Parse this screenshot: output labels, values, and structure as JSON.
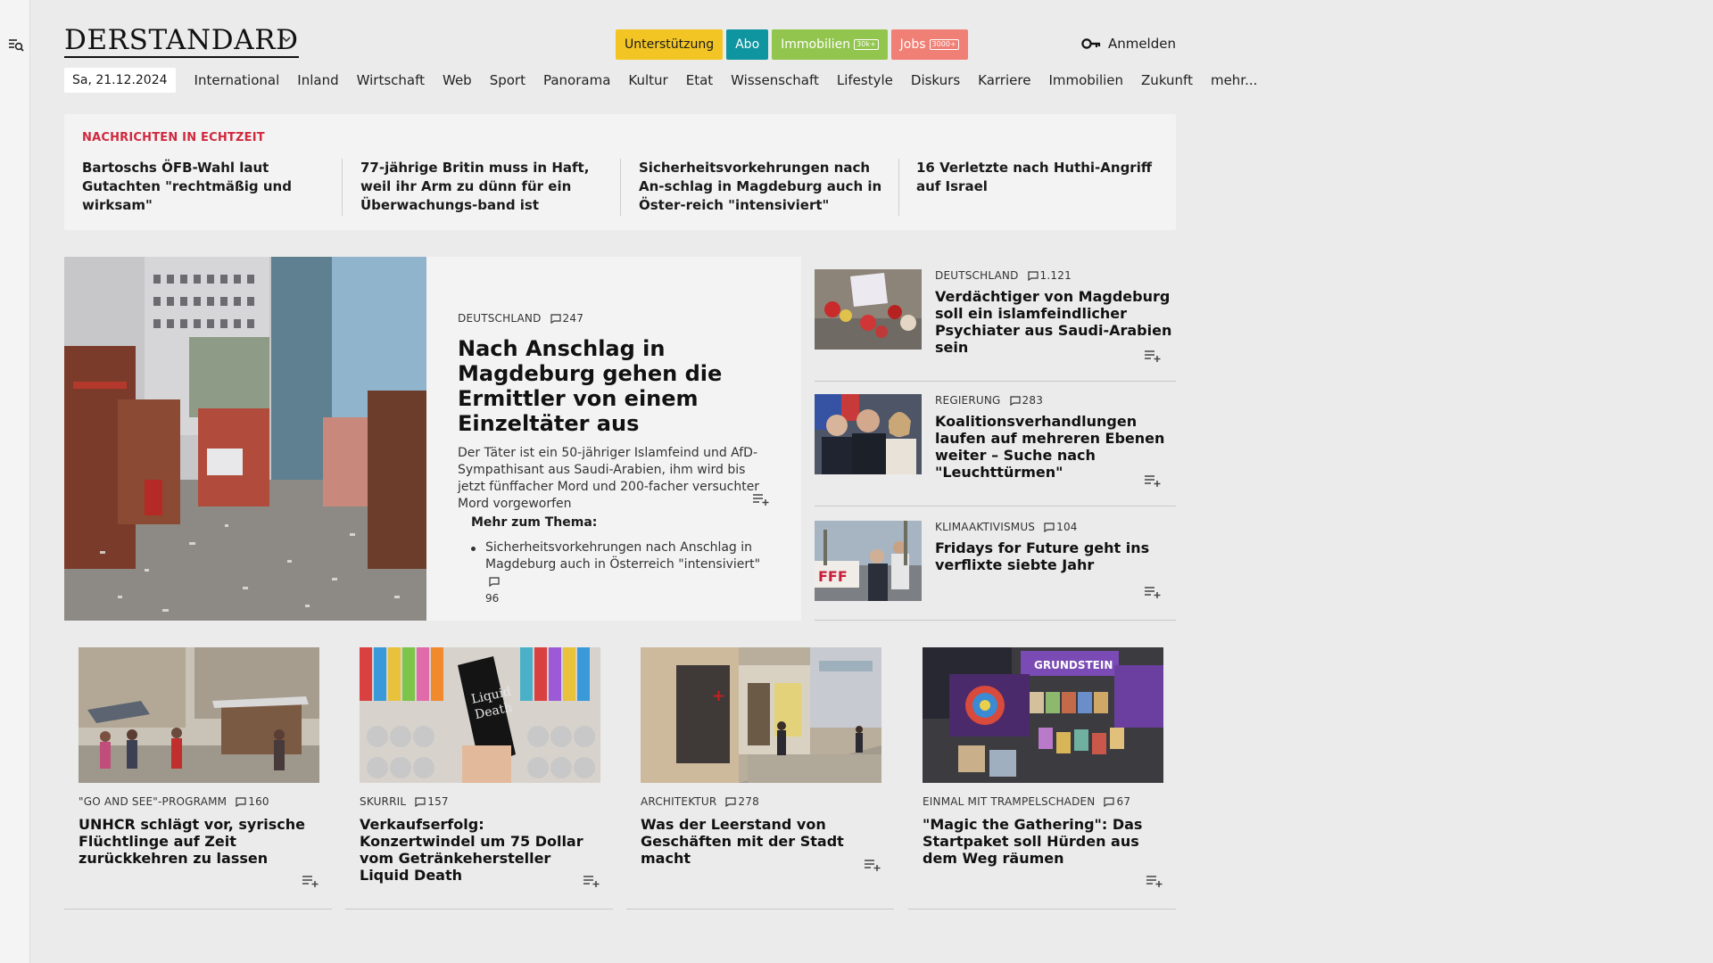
{
  "rail": {
    "icon": "search-menu-icon"
  },
  "header": {
    "logo": "DERSTANDARD",
    "buttons": {
      "support": "Unterstützung",
      "abo": "Abo",
      "immobilien": "Immobilien",
      "immobilien_badge": "30k+",
      "jobs": "Jobs",
      "jobs_badge": "3000+"
    },
    "login": "Anmelden"
  },
  "nav": {
    "date": "Sa, 21.12.2024",
    "items": [
      "International",
      "Inland",
      "Wirtschaft",
      "Web",
      "Sport",
      "Panorama",
      "Kultur",
      "Etat",
      "Wissenschaft",
      "Lifestyle",
      "Diskurs",
      "Karriere",
      "Immobilien",
      "Zukunft",
      "mehr..."
    ]
  },
  "live": {
    "title": "NACHRICHTEN IN ECHTZEIT",
    "items": [
      "Bartoschs ÖFB-Wahl laut Gutachten \"rechtmäßig und wirksam\"",
      "77-jährige Britin muss in Haft, weil ihr Arm zu dünn für ein Überwachungs-band ist",
      "Sicherheitsvorkehrungen nach An-schlag in Magdeburg auch in Öster-reich \"intensiviert\"",
      "16 Verletzte nach Huthi-Angriff auf Israel"
    ]
  },
  "hero": {
    "kicker": "DEUTSCHLAND",
    "comments": "247",
    "title": "Nach Anschlag in Magdeburg gehen die Ermittler von einem Einzeltäter aus",
    "lead": "Der Täter ist ein 50-jähriger Islamfeind und AfD-Sympathisant aus Saudi-Arabien, ihm wird bis jetzt fünffacher Mord und 200-facher versuchter Mord vorgeworfen",
    "more_title": "Mehr zum Thema:",
    "more_item": "Sicherheitsvorkehrungen nach Anschlag in Magdeburg auch in Österreich \"intensiviert\"",
    "more_comments": "96"
  },
  "side": [
    {
      "kicker": "DEUTSCHLAND",
      "comments": "1.121",
      "title": "Verdächtiger von Magdeburg soll ein islamfeindlicher Psychiater aus Saudi-Arabien sein"
    },
    {
      "kicker": "REGIERUNG",
      "comments": "283",
      "title": "Koalitionsverhandlungen laufen auf mehreren Ebenen weiter – Suche nach \"Leuchttürmen\""
    },
    {
      "kicker": "KLIMAAKTIVISMUS",
      "comments": "104",
      "title": "Fridays for Future geht ins verflixte siebte Jahr"
    }
  ],
  "cards": [
    {
      "kicker": "\"GO AND SEE\"-PROGRAMM",
      "comments": "160",
      "title": "UNHCR schlägt vor, syrische Flüchtlinge auf Zeit zurückkehren zu lassen"
    },
    {
      "kicker": "SKURRIL",
      "comments": "157",
      "title": "Verkaufserfolg: Konzertwindel um 75 Dollar vom Getränkehersteller Liquid Death"
    },
    {
      "kicker": "ARCHITEKTUR",
      "comments": "278",
      "title": "Was der Leerstand von Geschäften mit der Stadt macht"
    },
    {
      "kicker": "EINMAL MIT TRAMPELSCHADEN",
      "comments": "67",
      "title": "\"Magic the Gathering\": Das Startpaket soll Hürden aus dem Weg räumen"
    }
  ],
  "colors": {
    "live_accent": "#d0293e",
    "support": "#f3c524",
    "abo": "#0f95a0",
    "immobilien": "#92c54d",
    "jobs": "#f07f75"
  }
}
